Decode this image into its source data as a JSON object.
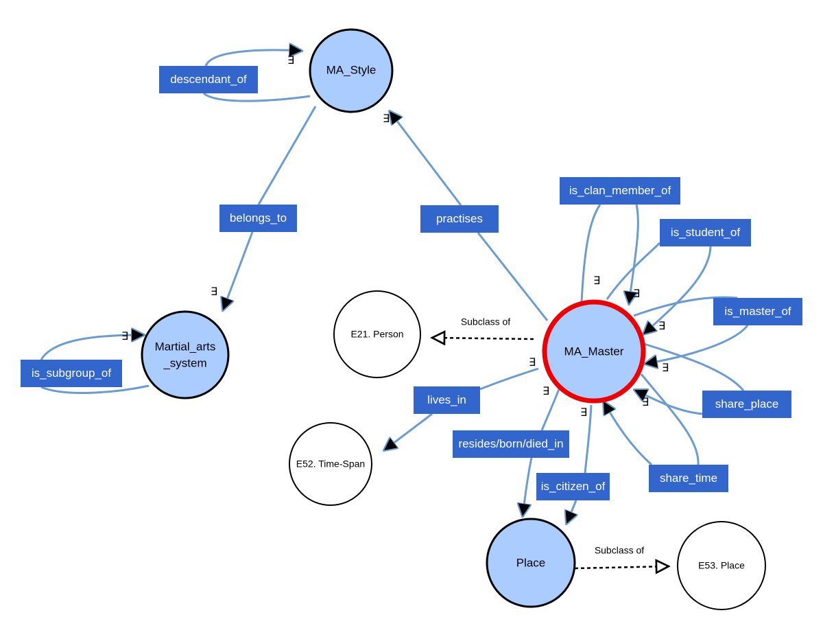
{
  "nodes": {
    "ma_style": "MA_Style",
    "martial_arts_system": [
      "Martial_arts",
      "_system"
    ],
    "ma_master": "MA_Master",
    "e21_person": "E21. Person",
    "e52_time_span": "E52. Time-Span",
    "place": "Place",
    "e53_place": "E53. Place"
  },
  "edge_labels": {
    "descendant_of": "descendant_of",
    "belongs_to": "belongs_to",
    "practises": "practises",
    "is_clan_member_of": "is_clan_member_of",
    "is_student_of": "is_student_of",
    "is_master_of": "is_master_of",
    "is_subgroup_of": "is_subgroup_of",
    "lives_in": "lives_in",
    "share_place": "share_place",
    "resides_born_died_in": "resides/born/died_in",
    "share_time": "share_time",
    "is_citizen_of": "is_citizen_of"
  },
  "subclass_label": "Subclass of",
  "exists_symbol": "∃",
  "colors": {
    "node_fill": "#aaccff",
    "label_fill": "#3366cc",
    "edge": "#6a9bd1",
    "highlight": "#ee0000"
  }
}
